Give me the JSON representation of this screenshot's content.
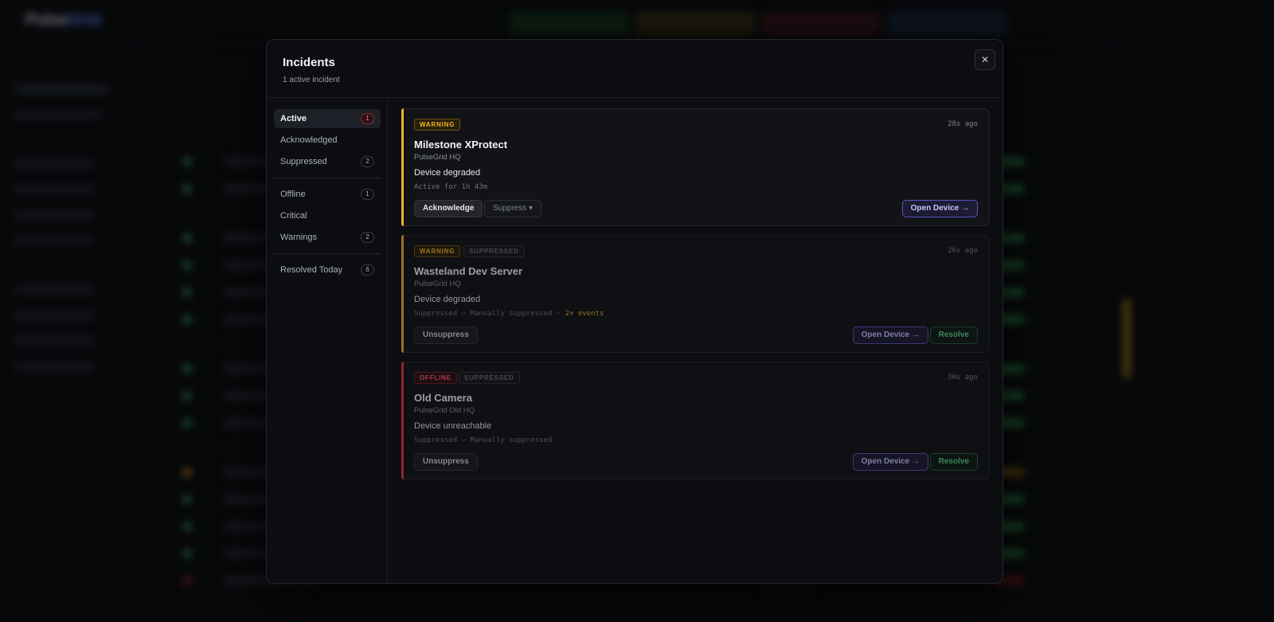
{
  "background": {
    "logo_main": "Pulse",
    "logo_accent": "Grid"
  },
  "modal": {
    "title": "Incidents",
    "subtitle": "1 active incident",
    "close_symbol": "✕"
  },
  "nav": {
    "items": [
      {
        "label": "Active",
        "count": "1"
      },
      {
        "label": "Acknowledged",
        "count": ""
      },
      {
        "label": "Suppressed",
        "count": "2"
      },
      {
        "label": "Offline",
        "count": "1"
      },
      {
        "label": "Critical",
        "count": ""
      },
      {
        "label": "Warnings",
        "count": "2"
      },
      {
        "label": "Resolved Today",
        "count": "6"
      }
    ]
  },
  "incidents": [
    {
      "severity": "WARNING",
      "suppressed_badge": "",
      "time": "28s ago",
      "name": "Milestone XProtect",
      "org": "PulseGrid HQ",
      "status": "Device degraded",
      "detail": "Active for 1h 43m",
      "detail_events": "",
      "buttons": {
        "acknowledge": "Acknowledge",
        "suppress": "Suppress ▾",
        "open": "Open Device →"
      }
    },
    {
      "severity": "WARNING",
      "suppressed_badge": "SUPPRESSED",
      "time": "26s ago",
      "name": "Wasteland Dev Server",
      "org": "PulseGrid HQ",
      "status": "Device degraded",
      "detail": "Suppressed — Manually suppressed",
      "detail_events": " · 2× events",
      "buttons": {
        "unsuppress": "Unsuppress",
        "open": "Open Device →",
        "resolve": "Resolve"
      }
    },
    {
      "severity": "OFFLINE",
      "suppressed_badge": "SUPPRESSED",
      "time": "30s ago",
      "name": "Old Camera",
      "org": "PulseGrid Old HQ",
      "status": "Device unreachable",
      "detail": "Suppressed — Manually suppressed",
      "detail_events": "",
      "buttons": {
        "unsuppress": "Unsuppress",
        "open": "Open Device →",
        "resolve": "Resolve"
      }
    }
  ],
  "colors": {
    "warning": "#f0b429",
    "offline": "#e5323f",
    "accent": "#5b55b8",
    "resolve": "#5dd08a"
  }
}
